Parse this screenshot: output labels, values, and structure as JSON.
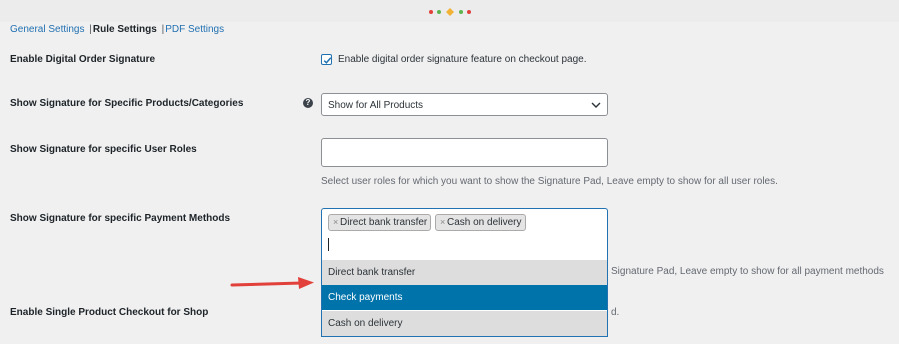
{
  "tabs": {
    "general": "General Settings",
    "separator": "|",
    "rule": "Rule Settings",
    "pdf": "PDF Settings"
  },
  "rows": {
    "enable_label": "Enable Digital Order Signature",
    "enable_checkbox_label": "Enable digital order signature feature on checkout page.",
    "enable_checked": true,
    "products_label": "Show Signature for Specific Products/Categories",
    "products_select_value": "Show for All Products",
    "roles_label": "Show Signature for specific User Roles",
    "roles_description": "Select user roles for which you want to show the Signature Pad, Leave empty to show for all user roles.",
    "payment_label": "Show Signature for specific Payment Methods",
    "payment_selected": [
      "Direct bank transfer",
      "Cash on delivery"
    ],
    "payment_options": [
      "Direct bank transfer",
      "Check payments",
      "Cash on delivery"
    ],
    "payment_highlighted": "Check payments",
    "payment_description_visible": "Signature Pad, Leave empty to show for all payment methods",
    "single_label": "Enable Single Product Checkout for Shop",
    "single_description_visible": "d."
  },
  "icons": {
    "help": "help-icon",
    "checkbox_check": "check-icon",
    "select_chevron": "chevron-down-icon",
    "chip_remove": "close-icon",
    "annotation_arrow": "arrow-right-icon"
  },
  "colors": {
    "accent": "#2271b1",
    "highlight": "#0073aa",
    "arrow": "#e2403a"
  }
}
